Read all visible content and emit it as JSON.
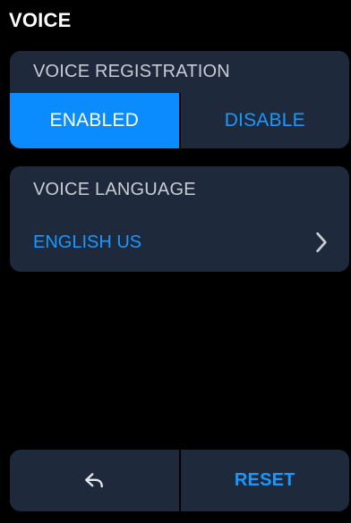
{
  "header": {
    "title": "VOICE"
  },
  "voice_registration": {
    "label": "VOICE REGISTRATION",
    "options": [
      {
        "label": "ENABLED",
        "selected": true
      },
      {
        "label": "DISABLE",
        "selected": false
      }
    ]
  },
  "voice_language": {
    "label": "VOICE LANGUAGE",
    "selected_language": "ENGLISH US",
    "chevron_icon": "chevron-right-icon"
  },
  "bottom_bar": {
    "back_icon": "back-icon",
    "reset_label": "RESET"
  },
  "colors": {
    "background": "#000000",
    "card": "#1e2a3b",
    "accent": "#0a8cff",
    "accent_text": "#1a98ff",
    "muted_text": "#c7ccd6",
    "white": "#ffffff"
  }
}
